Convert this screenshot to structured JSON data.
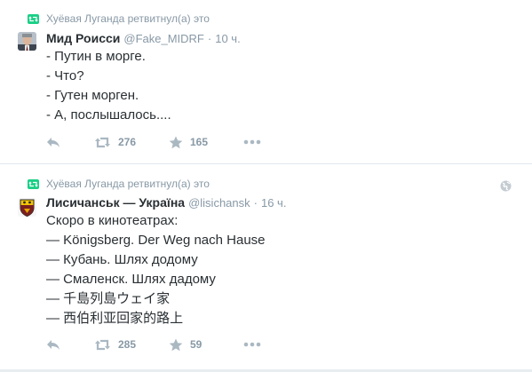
{
  "tweets": [
    {
      "retweeted_by_label": "Хуёвая Луганда ретвитнул(а) это",
      "author": {
        "fullname": "Мид Роисси",
        "username": "@Fake_MIDRF"
      },
      "separator": "·",
      "time": "10 ч.",
      "lines": [
        "- Путин в морге.",
        "- Что?",
        "- Гутен морген.",
        "- А, послышалось...."
      ],
      "retweet_count": "276",
      "favorite_count": "165"
    },
    {
      "retweeted_by_label": "Хуёвая Луганда ретвитнул(а) это",
      "author": {
        "fullname": "Лисичанськ — Україна",
        "username": "@lisichansk"
      },
      "separator": "·",
      "time": "16 ч.",
      "lines": [
        "Скоро в кинотеатрах:",
        "— Königsberg. Der Weg nach Hause",
        "— Кубань. Шлях додому",
        "— Смаленск. Шлях дадому",
        "— 千島列島ウェイ家",
        "— 西伯利亚回家的路上"
      ],
      "retweet_count": "285",
      "favorite_count": "59"
    }
  ],
  "colors": {
    "retweet_green": "#19cf86",
    "muted_text": "#8899a6",
    "icon_gray": "#aab8c2",
    "body_text": "#292f33"
  },
  "icons": {
    "retweet_context": "retweet-icon",
    "reply": "reply-icon",
    "retweet": "retweet-icon",
    "favorite": "star-icon",
    "more": "more-icon",
    "geo": "globe-icon"
  }
}
